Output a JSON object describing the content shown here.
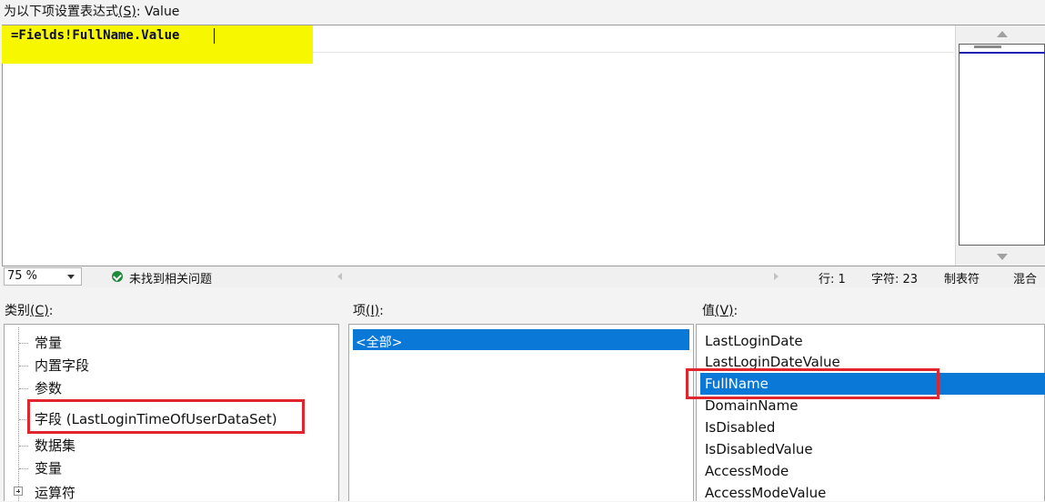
{
  "dialog": {
    "expression_label": "为以下项设置表达式",
    "expression_label_hotkey": "(S)",
    "expression_label_suffix": ": Value",
    "expression_text": "=Fields!FullName.Value"
  },
  "status": {
    "zoom": "75 %",
    "message": "未找到相关问题",
    "line": "行: 1",
    "char": "字符: 23",
    "tab": "制表符",
    "mixed": "混合"
  },
  "category": {
    "label": "类别",
    "hotkey": "(C)",
    "label_suffix": ":",
    "items": [
      "常量",
      "内置字段",
      "参数",
      "字段 (LastLoginTimeOfUserDataSet)",
      "数据集",
      "变量",
      "运算符"
    ]
  },
  "item_pane": {
    "label": "项",
    "hotkey": "(I)",
    "label_suffix": ":",
    "items": [
      "<全部>"
    ]
  },
  "value_pane": {
    "label": "值",
    "hotkey": "(V)",
    "label_suffix": ":",
    "items": [
      "LastLoginDate",
      "LastLoginDateValue",
      "FullName",
      "DomainName",
      "IsDisabled",
      "IsDisabledValue",
      "AccessMode",
      "AccessModeValue"
    ]
  },
  "colors": {
    "highlight": "#f7f700",
    "selection": "#0a78d7",
    "annotation_box": "#e0262c"
  }
}
